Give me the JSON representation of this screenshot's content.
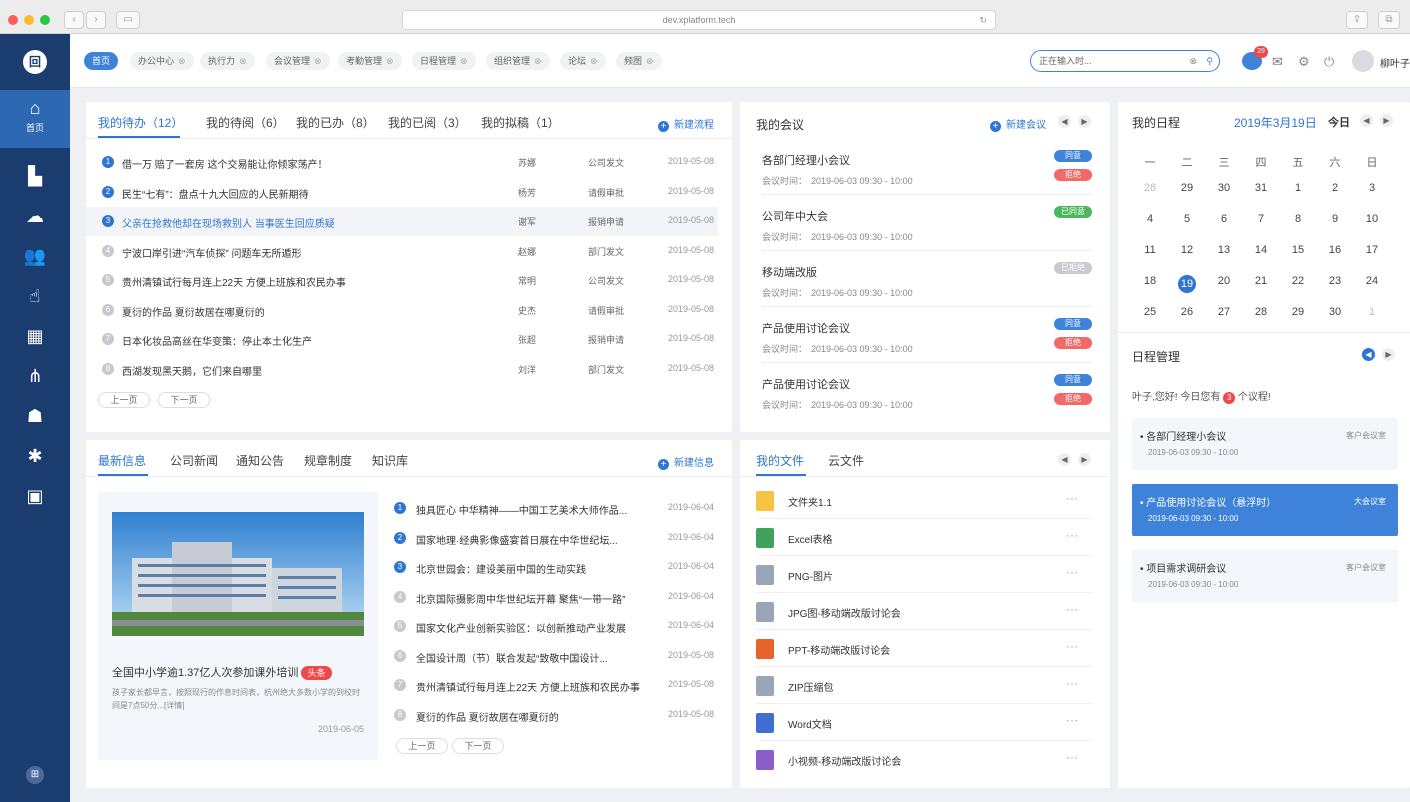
{
  "browser": {
    "url": "dev.xplatform.tech"
  },
  "sidebar": {
    "home_label": "首页",
    "icons": [
      "building-icon",
      "cloud-icon",
      "users-icon",
      "hand-icon",
      "calendar-icon",
      "org-chart-icon",
      "team-icon",
      "network-icon",
      "monitor-icon"
    ]
  },
  "nav": {
    "tabs": [
      "首页",
      "办公中心",
      "执行力",
      "会议管理",
      "考勤管理",
      "日程管理",
      "组织管理",
      "论坛",
      "频图"
    ],
    "search_value": "正在输入时...",
    "notify_count": "29",
    "user_name": "柳叶子"
  },
  "todo": {
    "tabs": [
      "我的待办（12）",
      "我的待阅（6）",
      "我的已办（8）",
      "我的已阅（3）",
      "我的拟稿（1）"
    ],
    "new_label": "新建流程",
    "rows": [
      {
        "n": "1",
        "title": "借一万 赔了一套房 这个交易能让你倾家荡产！",
        "person": "苏娜",
        "type": "公司发文",
        "date": "2019-05-08"
      },
      {
        "n": "2",
        "title": "民生“七有”：盘点十九大回应的人民新期待",
        "person": "杨芳",
        "type": "请假审批",
        "date": "2019-05-08"
      },
      {
        "n": "3",
        "title": "父亲在抢救他却在现场救别人 当事医生回应质疑",
        "person": "谢军",
        "type": "报销申请",
        "date": "2019-05-08"
      },
      {
        "n": "4",
        "title": "宁波口岸引进“汽车侦探” 问题车无所遁形",
        "person": "赵娜",
        "type": "部门发文",
        "date": "2019-05-08"
      },
      {
        "n": "5",
        "title": "贵州清镇试行每月连上22天 方便上班族和农民办事",
        "person": "常明",
        "type": "公司发文",
        "date": "2019-05-08"
      },
      {
        "n": "6",
        "title": "夏衍的作品 夏衍故居在哪夏衍的",
        "person": "史杰",
        "type": "请假审批",
        "date": "2019-05-08"
      },
      {
        "n": "7",
        "title": "日本化妆品高丝在华变策：停止本土化生产",
        "person": "张超",
        "type": "报销申请",
        "date": "2019-05-08"
      },
      {
        "n": "8",
        "title": "西湖发现黑天鹅，它们来自哪里",
        "person": "刘洋",
        "type": "部门发文",
        "date": "2019-05-08"
      }
    ],
    "prev": "上一页",
    "next": "下一页"
  },
  "meetings": {
    "title": "我的会议",
    "new_label": "新建会议",
    "time_label": "会议时间：",
    "items": [
      {
        "name": "各部门经理小会议",
        "time": "2019-06-03  09:30 - 10:00",
        "badges": [
          {
            "text": "同意",
            "color": "#3f82d9"
          },
          {
            "text": "拒绝",
            "color": "#f06a6a"
          }
        ]
      },
      {
        "name": "公司年中大会",
        "time": "2019-06-03  09:30 - 10:00",
        "badges": [
          {
            "text": "已同意",
            "color": "#4cb85c"
          }
        ]
      },
      {
        "name": "移动端改版",
        "time": "2019-06-03  09:30 - 10:00",
        "badges": [
          {
            "text": "已拒绝",
            "color": "#c9cbcf"
          }
        ]
      },
      {
        "name": "产品使用讨论会议",
        "time": "2019-06-03  09:30 - 10:00",
        "badges": [
          {
            "text": "同意",
            "color": "#3f82d9"
          },
          {
            "text": "拒绝",
            "color": "#f06a6a"
          }
        ]
      },
      {
        "name": "产品使用讨论会议",
        "time": "2019-06-03  09:30 - 10:00",
        "badges": [
          {
            "text": "同意",
            "color": "#3f82d9"
          },
          {
            "text": "拒绝",
            "color": "#f06a6a"
          }
        ]
      }
    ]
  },
  "schedule": {
    "title": "我的日程",
    "date": "2019年3月19日",
    "today_label": "今日",
    "weekdays": [
      "一",
      "二",
      "三",
      "四",
      "五",
      "六",
      "日"
    ],
    "weeks": [
      [
        "28",
        "29",
        "30",
        "31",
        "1",
        "2",
        "3"
      ],
      [
        "4",
        "5",
        "6",
        "7",
        "8",
        "9",
        "10"
      ],
      [
        "11",
        "12",
        "13",
        "14",
        "15",
        "16",
        "17"
      ],
      [
        "18",
        "19",
        "20",
        "21",
        "22",
        "23",
        "24"
      ],
      [
        "25",
        "26",
        "27",
        "28",
        "29",
        "30",
        "1"
      ]
    ],
    "manage_title": "日程管理",
    "greeting_pre": "叶子,您好! 今日您有",
    "greeting_count": "3",
    "greeting_post": "个议程!",
    "items": [
      {
        "name": "• 各部门经理小会议",
        "room": "客户会议室",
        "time": "2019-06-03  09:30 - 10:00"
      },
      {
        "name": "• 产品使用讨论会议（悬浮时）",
        "room": "大会议室",
        "time": "2019-06-03  09:30 - 10:00"
      },
      {
        "name": "• 项目需求调研会议",
        "room": "客户会议室",
        "time": "2019-06-03  09:30 - 10:00"
      }
    ]
  },
  "news": {
    "tabs": [
      "最新信息",
      "公司新闻",
      "通知公告",
      "规章制度",
      "知识库"
    ],
    "new_label": "新建信息",
    "feature": {
      "title": "全国中小学逾1.37亿人次参加课外培训",
      "tag": "头条",
      "desc": "孩子家长都早言，按照现行的作息时间表，杭州绝大多数小学的到校时间是7点50分...[详情]",
      "date": "2019-06-05"
    },
    "rows": [
      {
        "n": "1",
        "title": "独具匠心 中华精神——中国工艺美术大师作品...",
        "date": "2019-06-04"
      },
      {
        "n": "2",
        "title": "国家地理·经典影像盛宴首日展在中华世纪坛...",
        "date": "2019-06-04"
      },
      {
        "n": "3",
        "title": "北京世园会：建设美丽中国的生动实践",
        "date": "2019-06-04"
      },
      {
        "n": "4",
        "title": "北京国际摄影周中华世纪坛开幕 聚焦“一带一路”",
        "date": "2019-06-04"
      },
      {
        "n": "5",
        "title": "国家文化产业创新实验区：以创新推动产业发展",
        "date": "2019-06-04"
      },
      {
        "n": "6",
        "title": "全国设计周（节）联合发起“致敬中国设计...",
        "date": "2019-05-08"
      },
      {
        "n": "7",
        "title": "贵州清镇试行每月连上22天 方便上班族和农民办事",
        "date": "2019-05-08"
      },
      {
        "n": "8",
        "title": "夏衍的作品 夏衍故居在哪夏衍的",
        "date": "2019-05-08"
      }
    ],
    "prev": "上一页",
    "next": "下一页"
  },
  "files": {
    "tabs": [
      "我的文件",
      "云文件"
    ],
    "items": [
      {
        "name": "文件夹1.1",
        "icon": "folder-icon",
        "color": "#f6c343"
      },
      {
        "name": "Excel表格",
        "icon": "excel-icon",
        "color": "#3fa35b"
      },
      {
        "name": "PNG-图片",
        "icon": "png-icon",
        "color": "#9aa6b8"
      },
      {
        "name": "JPG图-移动端改版讨论会",
        "icon": "jpg-icon",
        "color": "#9aa6b8"
      },
      {
        "name": "PPT-移动端改版讨论会",
        "icon": "ppt-icon",
        "color": "#e8632b"
      },
      {
        "name": "ZIP压缩包",
        "icon": "zip-icon",
        "color": "#9aa6b8"
      },
      {
        "name": "Word文档",
        "icon": "word-icon",
        "color": "#3f6fd1"
      },
      {
        "name": "小视频-移动端改版讨论会",
        "icon": "video-icon",
        "color": "#8a5ec9"
      }
    ],
    "more": "···"
  }
}
